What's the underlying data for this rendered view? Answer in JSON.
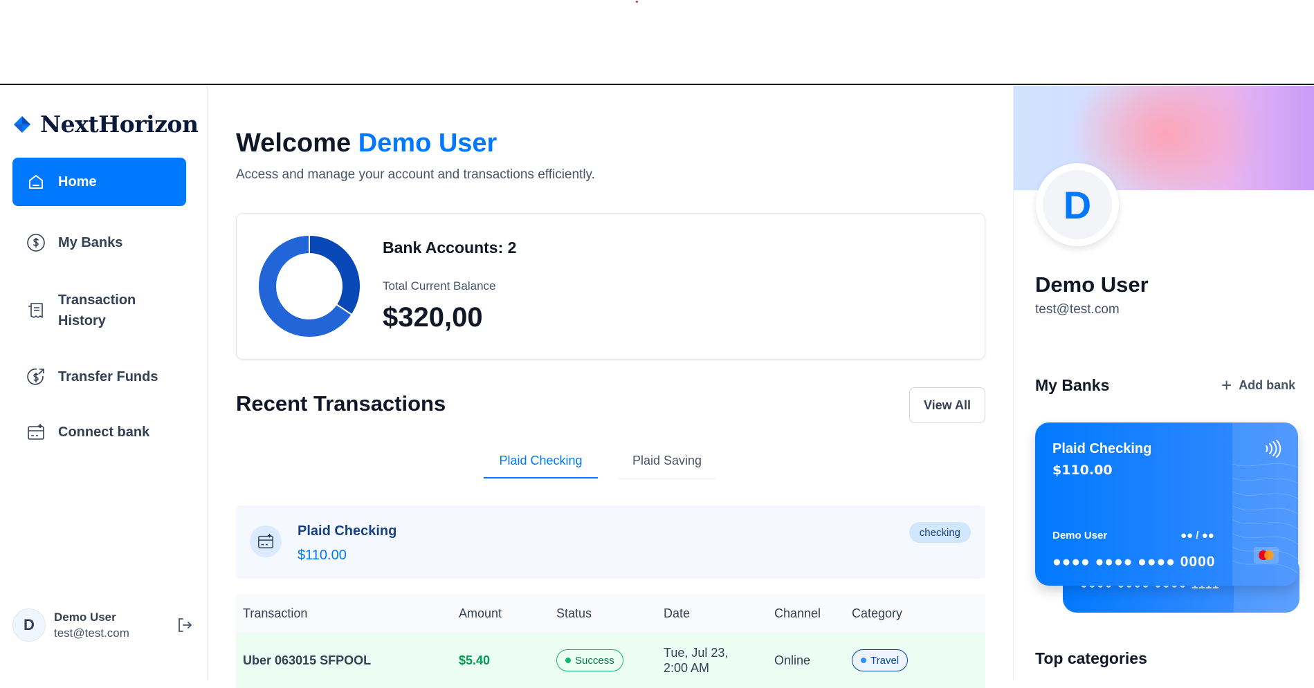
{
  "app": {
    "name": "NextHorizon"
  },
  "sidebar": {
    "items": [
      {
        "label": "Home",
        "icon": "home-icon",
        "active": true
      },
      {
        "label": "My Banks",
        "icon": "dollar-circle-icon"
      },
      {
        "label": "Transaction History",
        "label_line1": "Transaction",
        "label_line2": "History",
        "icon": "receipt-icon"
      },
      {
        "label": "Transfer Funds",
        "icon": "money-send-icon"
      },
      {
        "label": "Connect bank",
        "icon": "card-add-icon"
      }
    ],
    "footer": {
      "initial": "D",
      "name": "Demo User",
      "email": "test@test.com"
    }
  },
  "header": {
    "welcome": "Welcome",
    "user": "Demo User",
    "subtitle": "Access and manage your account and transactions efficiently."
  },
  "balance": {
    "accounts_label": "Bank Accounts: 2",
    "total_label": "Total Current Balance",
    "total_value": "$320,00"
  },
  "chart_data": {
    "type": "pie",
    "categories": [
      "Plaid Checking",
      "Plaid Saving"
    ],
    "values": [
      110,
      210
    ],
    "colors": [
      "#0747b6",
      "#2265d8"
    ]
  },
  "recent": {
    "title": "Recent Transactions",
    "view_all": "View All",
    "tabs": [
      "Plaid Checking",
      "Plaid Saving"
    ]
  },
  "account_banner": {
    "name": "Plaid Checking",
    "balance": "$110.00",
    "badge": "checking"
  },
  "table": {
    "columns": [
      "Transaction",
      "Amount",
      "Status",
      "Date",
      "Channel",
      "Category"
    ],
    "rows": [
      {
        "name": "Uber 063015 SFPOOL",
        "amount": "$5.40",
        "status": "Success",
        "date_line1": "Tue, Jul 23,",
        "date_line2": "2:00 AM",
        "channel": "Online",
        "category": "Travel"
      }
    ]
  },
  "right": {
    "initial": "D",
    "name": "Demo User",
    "email": "test@test.com",
    "my_banks": "My Banks",
    "add_bank": "Add bank",
    "cards": [
      {
        "name": "Plaid Checking",
        "balance": "$110.00",
        "owner": "Demo User",
        "expiry": "●● / ●●",
        "number": "●●●● ●●●● ●●●● 0000"
      },
      {
        "number": "●●●● ●●●● ●●●● 1111"
      }
    ],
    "top_categories": "Top categories"
  },
  "colors": {
    "primary": "#0179fe",
    "success": "#12b76a",
    "text": "#101828"
  }
}
